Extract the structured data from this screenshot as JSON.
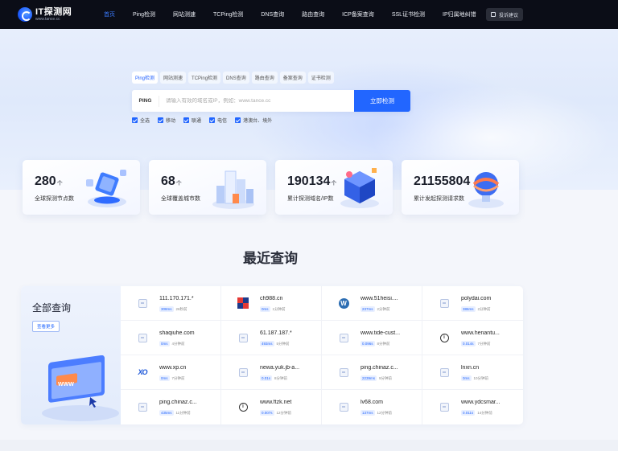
{
  "header": {
    "logo_title": "IT探测网",
    "logo_sub": "www.tance.cc",
    "nav": [
      {
        "label": "首页",
        "active": true
      },
      {
        "label": "Ping检测"
      },
      {
        "label": "网站测速"
      },
      {
        "label": "TCPing检测"
      },
      {
        "label": "DNS查询"
      },
      {
        "label": "路由查询"
      },
      {
        "label": "ICP备案查询"
      },
      {
        "label": "SSL证书检测"
      },
      {
        "label": "IP归属地纠错"
      }
    ],
    "feedback_label": "投诉建议"
  },
  "hero": {
    "tool_tabs": [
      "Ping检测",
      "网站测速",
      "TCPing检测",
      "DNS查询",
      "路由查询",
      "备案查询",
      "证书检测"
    ],
    "active_tab": 0,
    "search": {
      "protocol": "PING",
      "placeholder": "请输入有效的域名或IP，例如：www.tance.cc",
      "value": "",
      "button": "立即检测"
    },
    "filters": [
      "全选",
      "移动",
      "联通",
      "电信",
      "港澳台、境外"
    ]
  },
  "stats": [
    {
      "value": "280",
      "unit": "个",
      "label": "全球探测节点数",
      "icon": "node-network-illustration"
    },
    {
      "value": "68",
      "unit": "个",
      "label": "全球覆盖城市数",
      "icon": "city-buildings-illustration"
    },
    {
      "value": "190134",
      "unit": "个",
      "label": "累计探测域名/IP数",
      "icon": "domain-cube-illustration"
    },
    {
      "value": "21155804",
      "unit": "",
      "label": "累计发起探测请求数",
      "icon": "request-globe-illustration"
    }
  ],
  "recent": {
    "title": "最近查询",
    "all_label": "全部查询",
    "more_label": "查看更多",
    "items": [
      {
        "domain": "111.170.171.*",
        "ms": "308ms",
        "ago": "26秒前",
        "icon": "globe"
      },
      {
        "domain": "ch988.cn",
        "ms": "0ms",
        "ago": "1分钟前",
        "icon": "mosaic"
      },
      {
        "domain": "www.51heisi....",
        "ms": "237ms",
        "ago": "2分钟前",
        "icon": "wordpress"
      },
      {
        "domain": "polydai.com",
        "ms": "386ms",
        "ago": "2分钟前",
        "icon": "globe"
      },
      {
        "domain": "shaqiuhe.com",
        "ms": "0ms",
        "ago": "4分钟前",
        "icon": "globe"
      },
      {
        "domain": "61.187.187.*",
        "ms": "493ms",
        "ago": "5分钟前",
        "icon": "globe"
      },
      {
        "domain": "www.tide-cust...",
        "ms": "0.096s",
        "ago": "8分钟前",
        "icon": "globe"
      },
      {
        "domain": "www.henantu...",
        "ms": "0.014s",
        "ago": "7分钟前",
        "icon": "info"
      },
      {
        "domain": "www.xp.cn",
        "ms": "0ms",
        "ago": "7分钟前",
        "icon": "xo"
      },
      {
        "domain": "newa.yuk.jb-a...",
        "ms": "0.01s",
        "ago": "8分钟前",
        "icon": "globe"
      },
      {
        "domain": "ping.chinaz.c...",
        "ms": "2239ms",
        "ago": "9分钟前",
        "icon": "globe"
      },
      {
        "domain": "lnxn.cn",
        "ms": "0ms",
        "ago": "10分钟前",
        "icon": "globe"
      },
      {
        "domain": "ping.chinaz.c...",
        "ms": "435ms",
        "ago": "11分钟前",
        "icon": "globe"
      },
      {
        "domain": "www.ftzk.net",
        "ms": "0.007s",
        "ago": "12分钟前",
        "icon": "info"
      },
      {
        "domain": "lv68.com",
        "ms": "137ms",
        "ago": "12分钟前",
        "icon": "globe"
      },
      {
        "domain": "www.ydcsmar...",
        "ms": "0.011s",
        "ago": "14分钟前",
        "icon": "globe"
      }
    ]
  },
  "colors": {
    "header_bg": "#0b0d17",
    "accent": "#2266ff",
    "nav_active": "#3b7bff"
  }
}
